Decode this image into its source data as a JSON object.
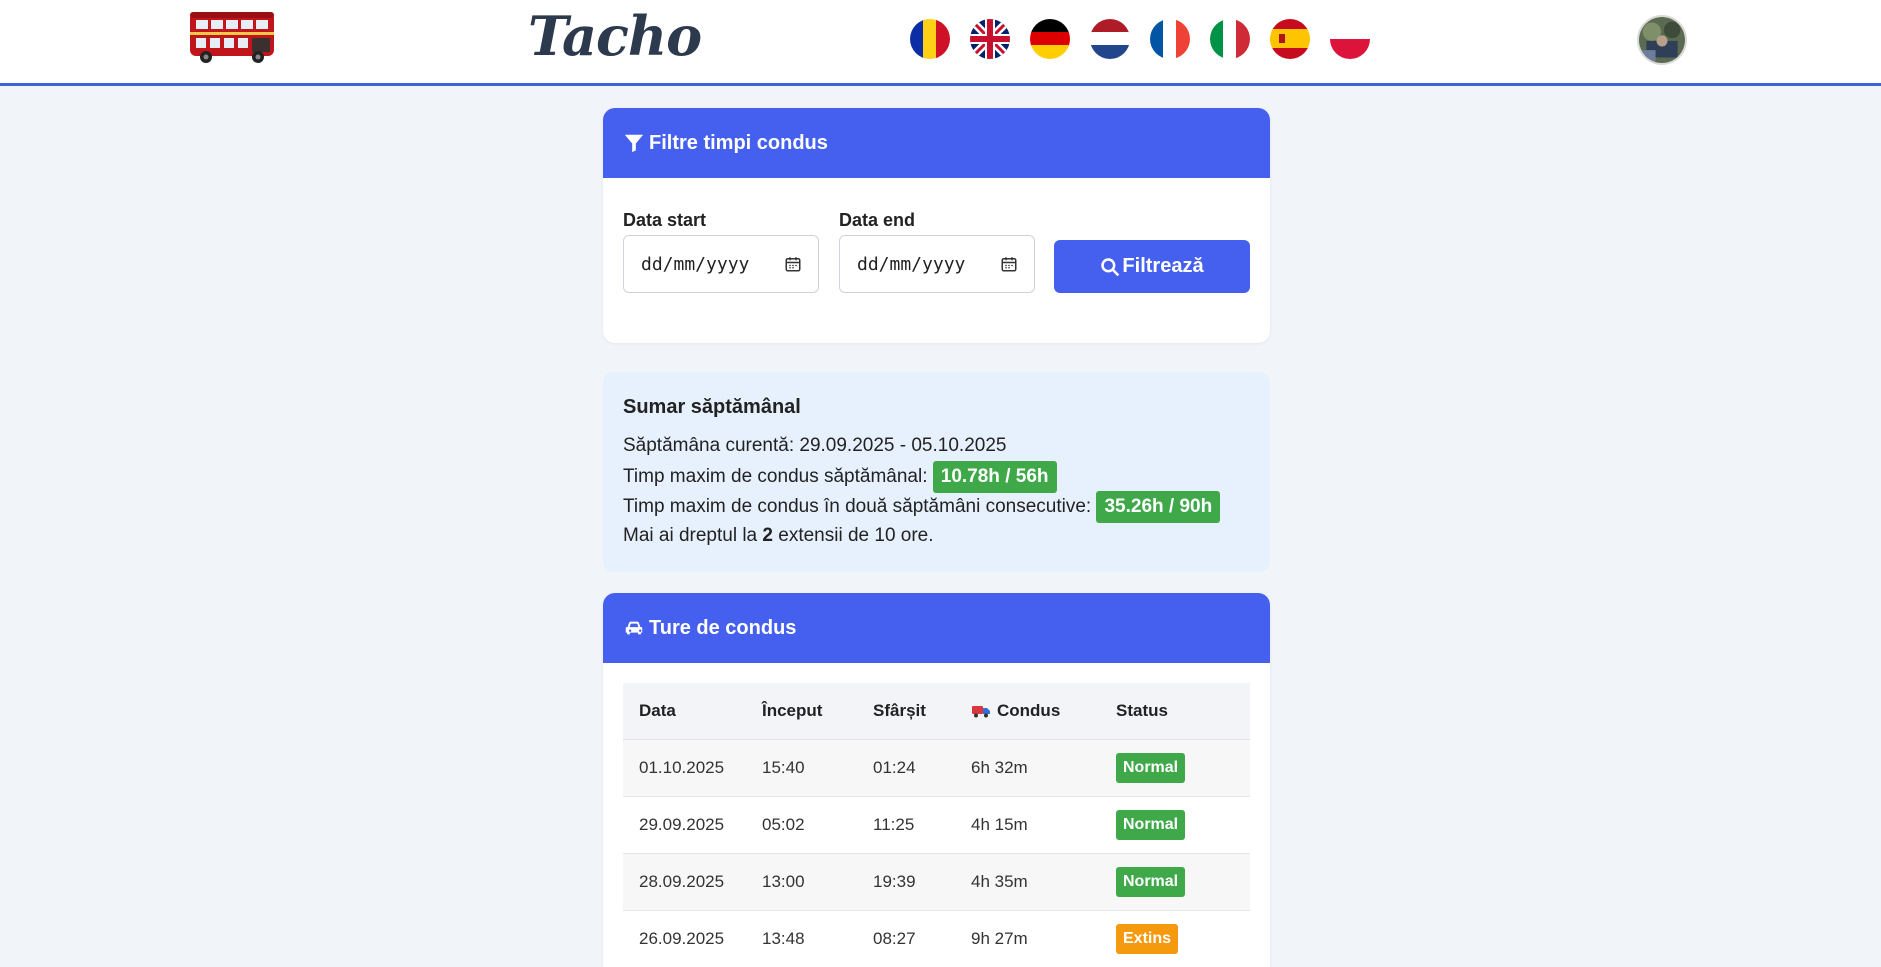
{
  "header": {
    "brand": "Tacho",
    "flags": [
      "romania-flag-icon",
      "uk-flag-icon",
      "germany-flag-icon",
      "netherlands-flag-icon",
      "france-flag-icon",
      "italy-flag-icon",
      "spain-flag-icon",
      "poland-flag-icon"
    ]
  },
  "filters": {
    "title": "Filtre timpi condus",
    "start_label": "Data start",
    "start_placeholder": "dd/mm/yyyy",
    "end_label": "Data end",
    "end_placeholder": "dd/mm/yyyy",
    "button_label": "Filtrează"
  },
  "summary": {
    "title": "Sumar săptămânal",
    "current_week_label": "Săptămâna curentă: 29.09.2025 - 05.10.2025",
    "weekly_label": "Timp maxim de condus săptămânal:",
    "weekly_value": "10.78h / 56h",
    "biweekly_label": "Timp maxim de condus în două săptămâni consecutive:",
    "biweekly_value": "35.26h / 90h",
    "ext_prefix": "Mai ai dreptul la",
    "ext_count": "2",
    "ext_suffix": "extensii de 10 ore."
  },
  "shifts": {
    "title": "Ture de condus",
    "columns": [
      "Data",
      "Început",
      "Sfârșit",
      "Condus",
      "Status"
    ],
    "rows": [
      {
        "date": "01.10.2025",
        "start": "15:40",
        "end": "01:24",
        "driven": "6h 32m",
        "status": "Normal"
      },
      {
        "date": "29.09.2025",
        "start": "05:02",
        "end": "11:25",
        "driven": "4h 15m",
        "status": "Normal"
      },
      {
        "date": "28.09.2025",
        "start": "13:00",
        "end": "19:39",
        "driven": "4h 35m",
        "status": "Normal"
      },
      {
        "date": "26.09.2025",
        "start": "13:48",
        "end": "08:27",
        "driven": "9h 27m",
        "status": "Extins"
      }
    ]
  },
  "colors": {
    "accent": "#4560ee",
    "success": "#3fa94a",
    "warning": "#f59a0f",
    "summary_bg": "#e7f1fd"
  }
}
